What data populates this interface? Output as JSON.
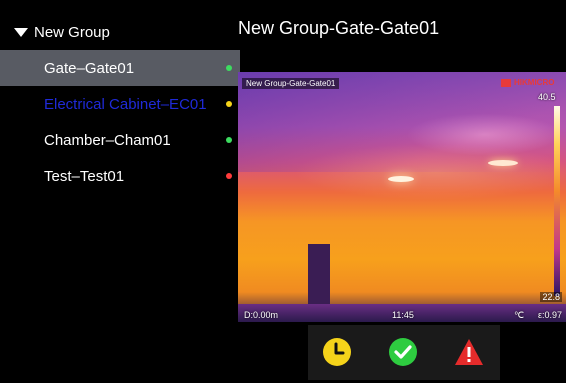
{
  "sidebar": {
    "group_label": "New Group",
    "devices": [
      {
        "label": "Gate–Gate01",
        "status_color": "#3ddc60",
        "text_color": "#ffffff",
        "selected": true
      },
      {
        "label": "Electrical Cabinet–EC01",
        "status_color": "#f5d31a",
        "text_color": "#1f2ad8",
        "selected": false
      },
      {
        "label": "Chamber–Cham01",
        "status_color": "#3ddc60",
        "text_color": "#ffffff",
        "selected": false
      },
      {
        "label": "Test–Test01",
        "status_color": "#ff3b3b",
        "text_color": "#ffffff",
        "selected": false
      }
    ]
  },
  "main": {
    "title": "New Group-Gate-Gate01"
  },
  "thermal_view": {
    "overlay_title": "New Group-Gate-Gate01",
    "brand": "HIKMICRO",
    "scale_max": "40.5",
    "scale_min": "22.8",
    "distance": "D:0.00m",
    "time": "11:45",
    "unit": "℃",
    "emissivity": "ε:0.97"
  },
  "status_bar": {
    "icons": [
      "clock-icon",
      "checkmark-icon",
      "warning-icon"
    ],
    "colors": {
      "clock": "#f5d31a",
      "ok": "#2ecc40",
      "warn": "#e52b2b"
    }
  }
}
